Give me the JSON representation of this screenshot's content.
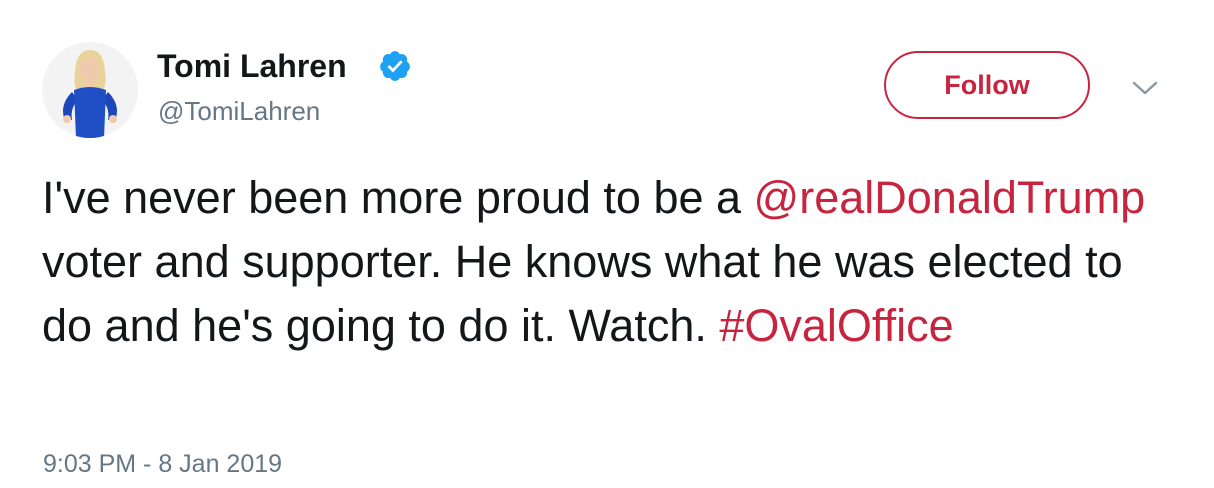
{
  "author": {
    "display_name": "Tomi Lahren",
    "handle": "@TomiLahren",
    "verified": true,
    "avatar_icon": "profile-photo"
  },
  "actions": {
    "follow_label": "Follow",
    "more_icon": "chevron-down-icon"
  },
  "tweet": {
    "segments": [
      {
        "type": "text",
        "value": "I've never been more proud to be a "
      },
      {
        "type": "mention",
        "value": "@realDonaldTrump"
      },
      {
        "type": "text",
        "value": " voter and supporter. He knows what he was elected to do and he's going to do it. Watch. "
      },
      {
        "type": "hashtag",
        "value": "#OvalOffice"
      }
    ]
  },
  "timestamp": "9:03 PM - 8 Jan 2019",
  "colors": {
    "accent": "#c7253f",
    "text": "#14171a",
    "secondary": "#657786",
    "verified_badge": "#1da1f2"
  }
}
